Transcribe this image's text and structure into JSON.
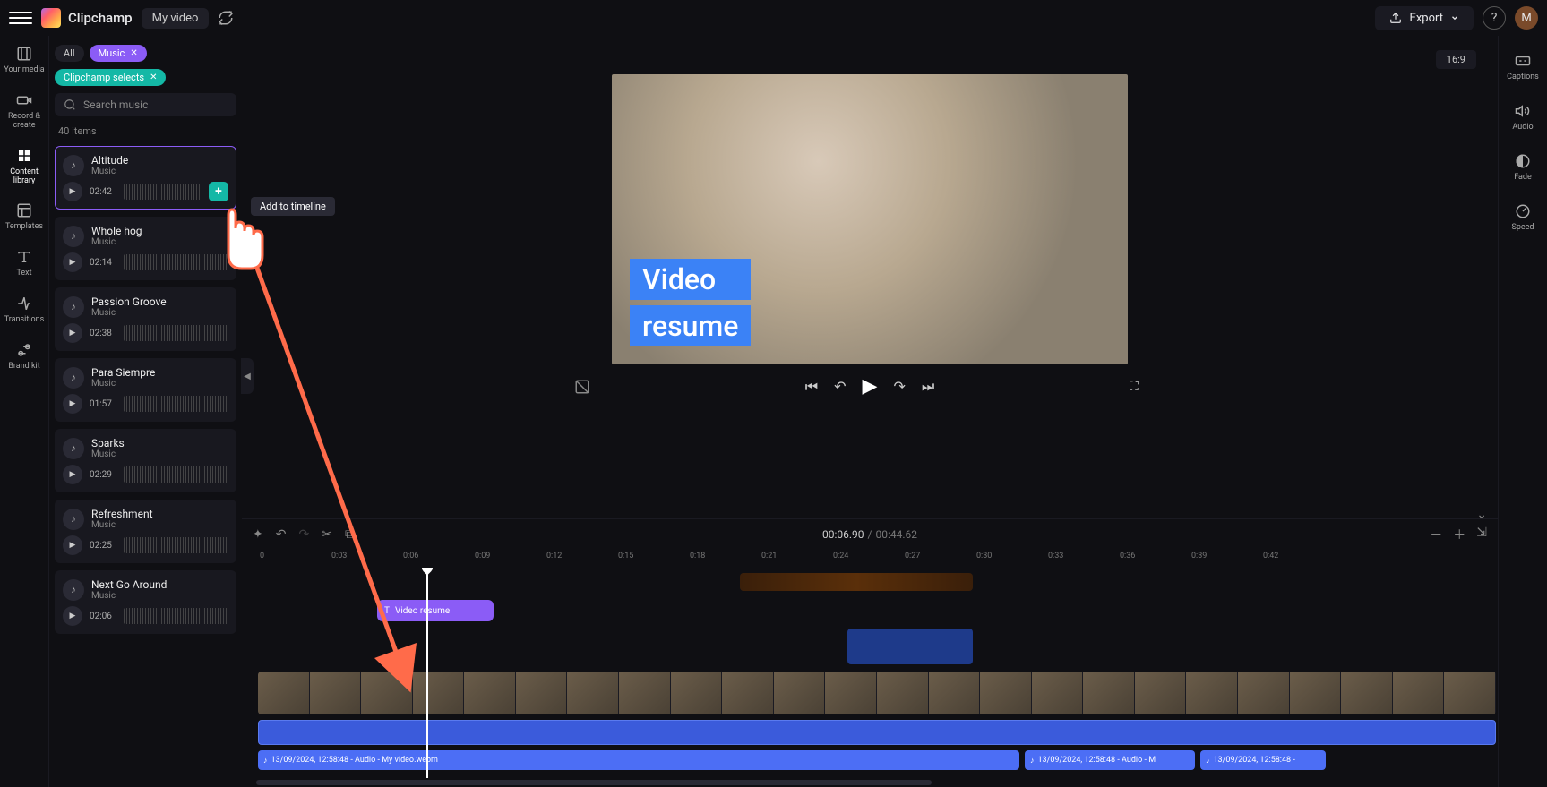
{
  "header": {
    "app_name": "Clipchamp",
    "project_name": "My video",
    "export_label": "Export",
    "avatar_initial": "M"
  },
  "leftrail": [
    {
      "label": "Your media"
    },
    {
      "label": "Record & create"
    },
    {
      "label": "Content library"
    },
    {
      "label": "Templates"
    },
    {
      "label": "Text"
    },
    {
      "label": "Transitions"
    },
    {
      "label": "Brand kit"
    }
  ],
  "rightrail": [
    {
      "label": "Captions"
    },
    {
      "label": "Audio"
    },
    {
      "label": "Fade"
    },
    {
      "label": "Speed"
    }
  ],
  "panel": {
    "chip_all": "All",
    "chip_music": "Music",
    "chip_selects": "Clipchamp selects",
    "search_placeholder": "Search music",
    "item_count": "40 items",
    "add_tooltip": "Add to timeline"
  },
  "music": [
    {
      "title": "Altitude",
      "sub": "Music",
      "dur": "02:42",
      "selected": true,
      "add": true
    },
    {
      "title": "Whole hog",
      "sub": "Music",
      "dur": "02:14"
    },
    {
      "title": "Passion Groove",
      "sub": "Music",
      "dur": "02:38"
    },
    {
      "title": "Para Siempre",
      "sub": "Music",
      "dur": "01:57"
    },
    {
      "title": "Sparks",
      "sub": "Music",
      "dur": "02:29"
    },
    {
      "title": "Refreshment",
      "sub": "Music",
      "dur": "02:25"
    },
    {
      "title": "Next Go Around",
      "sub": "Music",
      "dur": "02:06"
    }
  ],
  "preview": {
    "ratio": "16:9",
    "text_line1": "Video",
    "text_line2": "resume"
  },
  "timeline": {
    "current": "00:06.90",
    "sep": "/",
    "total": "00:44.62",
    "purple_clip": "Video resume",
    "audio_label1": "13/09/2024, 12:58:48 - Audio - My video.webm",
    "audio_label2": "13/09/2024, 12:58:48 - Audio - M",
    "audio_label3": "13/09/2024, 12:58:48 -",
    "ruler": [
      "0",
      "0:03",
      "0:06",
      "0:09",
      "0:12",
      "0:15",
      "0:18",
      "0:21",
      "0:24",
      "0:27",
      "0:30",
      "0:33",
      "0:36",
      "0:39",
      "0:42"
    ]
  }
}
